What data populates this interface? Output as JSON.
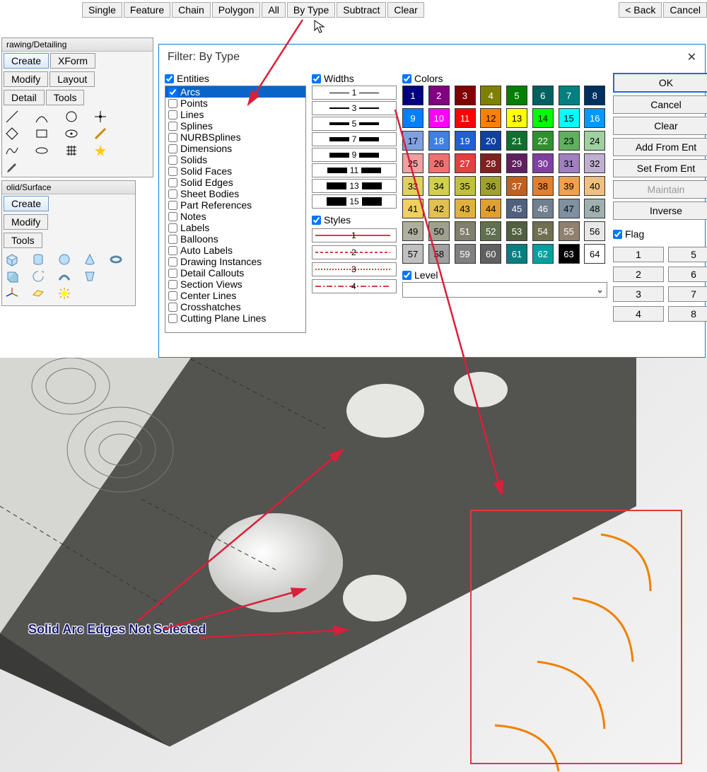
{
  "toolbar": {
    "buttons": [
      "Single",
      "Feature",
      "Chain",
      "Polygon",
      "All",
      "By Type",
      "Subtract",
      "Clear"
    ],
    "right_buttons": [
      "< Back",
      "Cancel"
    ]
  },
  "panels": {
    "drawing": {
      "title": "rawing/Detailing",
      "rows": [
        [
          "Create",
          "XForm"
        ],
        [
          "Modify",
          "Layout"
        ],
        [
          "Detail",
          "Tools"
        ]
      ]
    },
    "solid": {
      "title": "olid/Surface",
      "rows": [
        [
          "Create"
        ],
        [
          "Modify"
        ],
        [
          "Tools"
        ]
      ]
    }
  },
  "dialog": {
    "title": "Filter: By Type",
    "entities_label": "Entities",
    "entities": [
      "Arcs",
      "Points",
      "Lines",
      "Splines",
      "NURBSplines",
      "Dimensions",
      "Solids",
      "Solid Faces",
      "Solid Edges",
      "Sheet Bodies",
      "Part References",
      "Notes",
      "Labels",
      "Balloons",
      "Auto Labels",
      "Drawing Instances",
      "Detail Callouts",
      "Section Views",
      "Center Lines",
      "Crosshatches",
      "Cutting Plane Lines"
    ],
    "entities_selected_index": 0,
    "entities_checked_indices": [
      0
    ],
    "widths_label": "Widths",
    "widths": [
      "1",
      "3",
      "5",
      "7",
      "9",
      "11",
      "13",
      "15"
    ],
    "styles_label": "Styles",
    "style_numbers": [
      "1",
      "2",
      "3",
      "4"
    ],
    "colors_label": "Colors",
    "colors": [
      {
        "n": "1",
        "c": "#000080"
      },
      {
        "n": "2",
        "c": "#800080"
      },
      {
        "n": "3",
        "c": "#800000"
      },
      {
        "n": "4",
        "c": "#808000"
      },
      {
        "n": "5",
        "c": "#008000"
      },
      {
        "n": "6",
        "c": "#006060"
      },
      {
        "n": "7",
        "c": "#008080"
      },
      {
        "n": "8",
        "c": "#003060"
      },
      {
        "n": "9",
        "c": "#0080ff"
      },
      {
        "n": "10",
        "c": "#ff00ff"
      },
      {
        "n": "11",
        "c": "#ff0000"
      },
      {
        "n": "12",
        "c": "#ff8000"
      },
      {
        "n": "13",
        "c": "#ffff00"
      },
      {
        "n": "14",
        "c": "#00ff00"
      },
      {
        "n": "15",
        "c": "#00ffff"
      },
      {
        "n": "16",
        "c": "#0099ff"
      },
      {
        "n": "17",
        "c": "#80a0e0"
      },
      {
        "n": "18",
        "c": "#4080e0"
      },
      {
        "n": "19",
        "c": "#2060d0"
      },
      {
        "n": "20",
        "c": "#1040a0"
      },
      {
        "n": "21",
        "c": "#107030"
      },
      {
        "n": "22",
        "c": "#309030"
      },
      {
        "n": "23",
        "c": "#60b060"
      },
      {
        "n": "24",
        "c": "#a0d0a0"
      },
      {
        "n": "25",
        "c": "#f0a0a0"
      },
      {
        "n": "26",
        "c": "#f07070"
      },
      {
        "n": "27",
        "c": "#e04040"
      },
      {
        "n": "28",
        "c": "#802020"
      },
      {
        "n": "29",
        "c": "#602060"
      },
      {
        "n": "30",
        "c": "#8040a0"
      },
      {
        "n": "31",
        "c": "#a080c0"
      },
      {
        "n": "32",
        "c": "#c0b0d0"
      },
      {
        "n": "33",
        "c": "#e0d060"
      },
      {
        "n": "34",
        "c": "#d0d050"
      },
      {
        "n": "35",
        "c": "#c0c040"
      },
      {
        "n": "36",
        "c": "#a0a030"
      },
      {
        "n": "37",
        "c": "#c06020"
      },
      {
        "n": "38",
        "c": "#e08030"
      },
      {
        "n": "39",
        "c": "#f0a050"
      },
      {
        "n": "40",
        "c": "#f0c080"
      },
      {
        "n": "41",
        "c": "#f0d060"
      },
      {
        "n": "42",
        "c": "#e0c050"
      },
      {
        "n": "43",
        "c": "#e0b040"
      },
      {
        "n": "44",
        "c": "#e0a030"
      },
      {
        "n": "45",
        "c": "#506080"
      },
      {
        "n": "46",
        "c": "#708090"
      },
      {
        "n": "47",
        "c": "#8090a0"
      },
      {
        "n": "48",
        "c": "#a0b0b0"
      },
      {
        "n": "49",
        "c": "#b0b0a0"
      },
      {
        "n": "50",
        "c": "#a0a090"
      },
      {
        "n": "51",
        "c": "#808070"
      },
      {
        "n": "52",
        "c": "#607050"
      },
      {
        "n": "53",
        "c": "#506040"
      },
      {
        "n": "54",
        "c": "#707050"
      },
      {
        "n": "55",
        "c": "#908070"
      },
      {
        "n": "56",
        "c": "#e8e8e8"
      },
      {
        "n": "57",
        "c": "#c0c0c0"
      },
      {
        "n": "58",
        "c": "#a0a0a0"
      },
      {
        "n": "59",
        "c": "#808080"
      },
      {
        "n": "60",
        "c": "#606060"
      },
      {
        "n": "61",
        "c": "#008080"
      },
      {
        "n": "62",
        "c": "#00a0a0"
      },
      {
        "n": "63",
        "c": "#000000"
      },
      {
        "n": "64",
        "c": "#ffffff"
      }
    ],
    "level_label": "Level",
    "buttons": {
      "ok": "OK",
      "cancel": "Cancel",
      "clear": "Clear",
      "add": "Add From Ent",
      "set": "Set From Ent",
      "maintain": "Maintain",
      "inverse": "Inverse"
    },
    "flag_label": "Flag",
    "flag_buttons": [
      "1",
      "5",
      "2",
      "6",
      "3",
      "7",
      "4",
      "8"
    ]
  },
  "annotation": {
    "text": "Solid Arc Edges Not Selected"
  }
}
